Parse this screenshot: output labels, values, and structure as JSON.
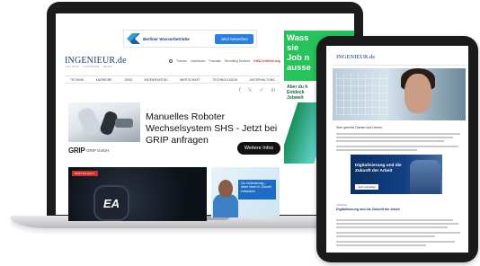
{
  "laptop": {
    "top_ad": {
      "brand": "Berliner Wasserbetriebe",
      "cta": "Jetzt bewerben"
    },
    "site": {
      "logo": "INGENIEUR.de",
      "tagline": "TECHNIK · KARRIERE · NEWS",
      "util_links": [
        "Themen",
        "Impressum",
        "Podcasts",
        "Recruiting Services"
      ],
      "util_link_highlight": "KWA Zertifizierung",
      "nav": [
        "TECHNIK",
        "KARRIERE",
        "JOBS",
        "INGENIEURTAG",
        "WIRTSCHAFT",
        "TECHNOLOGIEN",
        "UNTERHALTUNG"
      ],
      "social": [
        "f",
        "𝕏",
        "✓",
        "in"
      ]
    },
    "product_ad": {
      "title": "Manuelles Roboter Wechselsystem SHS - Jetzt bei GRIP anfragen",
      "company_logo": "GRIP",
      "company": "GRIP GmbH",
      "button": "Weitere Infos"
    },
    "sky_ad": {
      "big": "Wass\nsie\nJob n\nausse",
      "small": "Aber du h\nEntdeck\nJobwelt"
    },
    "cards": {
      "ea_tag": "WIRTSCHAFT",
      "ea_logo": "EA",
      "person_text": "Zur Veränderung – deine Ideen in Zukunft entwickeln"
    },
    "colors": {
      "brand_blue": "#1e3a6e",
      "cta_blue": "#2a7de1",
      "ad_green": "#26c25a",
      "tag_red": "#c73426"
    }
  },
  "tablet": {
    "logo": "INGENIEUR.de",
    "salutation": "Sehr geehrte Damen und Herren,",
    "banner": {
      "title": "Digitalisierung und die Zukunft der Arbeit",
      "button": "Jetzt anmelden"
    },
    "label": "ANZEIGE",
    "article_title": "Digitalisierung und die Zukunft der Arbeit"
  }
}
